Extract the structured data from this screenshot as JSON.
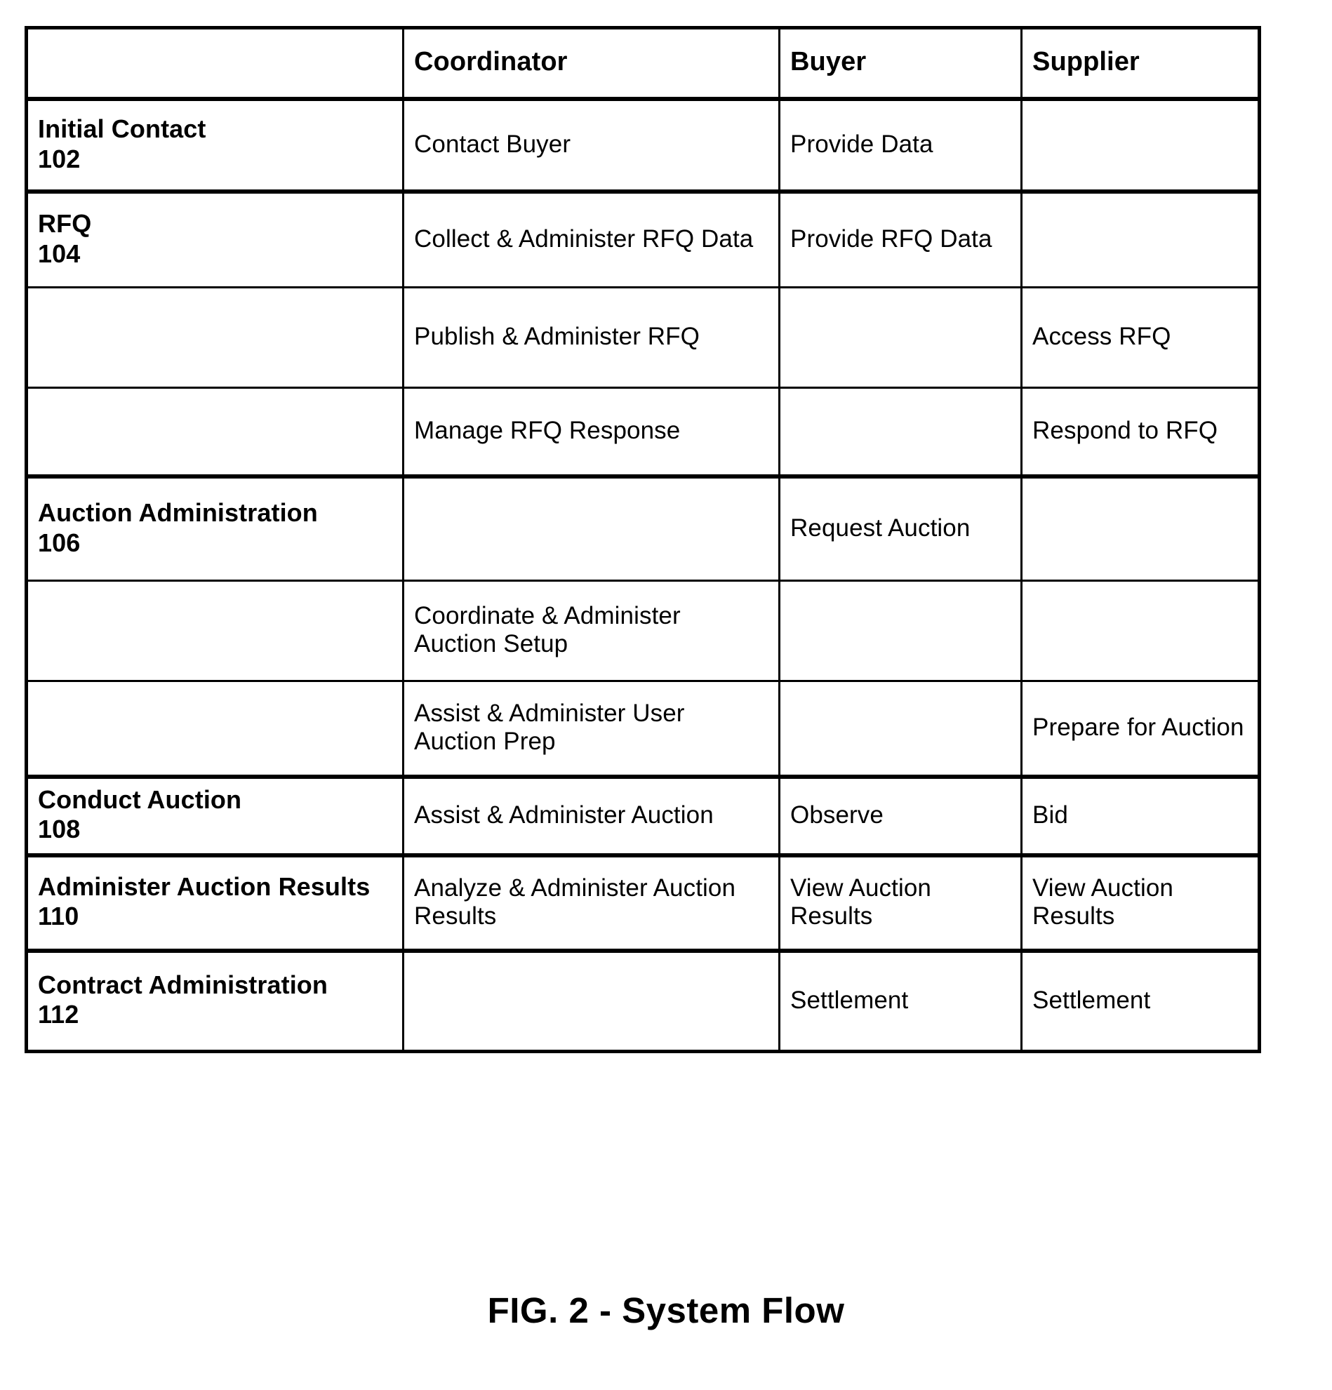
{
  "figure": {
    "caption": "FIG. 2 - System Flow"
  },
  "table": {
    "columns": [
      {
        "key": "phase",
        "label": ""
      },
      {
        "key": "coordinator",
        "label": "Coordinator"
      },
      {
        "key": "buyer",
        "label": "Buyer"
      },
      {
        "key": "supplier",
        "label": "Supplier"
      }
    ],
    "rows": [
      {
        "phase_name": "Initial Contact",
        "phase_number": "102",
        "coordinator": "Contact Buyer",
        "buyer": "Provide Data",
        "supplier": ""
      },
      {
        "phase_name": "RFQ",
        "phase_number": "104",
        "coordinator": "Collect & Administer RFQ Data",
        "buyer": "Provide RFQ Data",
        "supplier": ""
      },
      {
        "phase_name": "",
        "phase_number": "",
        "coordinator": "Publish & Administer RFQ",
        "buyer": "",
        "supplier": "Access RFQ"
      },
      {
        "phase_name": "",
        "phase_number": "",
        "coordinator": "Manage RFQ Response",
        "buyer": "",
        "supplier": "Respond to RFQ"
      },
      {
        "phase_name": "Auction Administration",
        "phase_number": "106",
        "coordinator": "",
        "buyer": "Request Auction",
        "supplier": ""
      },
      {
        "phase_name": "",
        "phase_number": "",
        "coordinator": "Coordinate & Administer Auction Setup",
        "buyer": "",
        "supplier": ""
      },
      {
        "phase_name": "",
        "phase_number": "",
        "coordinator": "Assist & Administer User Auction Prep",
        "buyer": "",
        "supplier": "Prepare for Auction"
      },
      {
        "phase_name": "Conduct Auction",
        "phase_number": "108",
        "coordinator": "Assist & Administer Auction",
        "buyer": "Observe",
        "supplier": "Bid"
      },
      {
        "phase_name": "Administer Auction Results",
        "phase_number": "110",
        "coordinator": "Analyze & Administer Auction Results",
        "buyer": "View Auction Results",
        "supplier": "View Auction Results"
      },
      {
        "phase_name": "Contract Administration",
        "phase_number": "112",
        "coordinator": "",
        "buyer": "Settlement",
        "supplier": "Settlement"
      }
    ]
  }
}
